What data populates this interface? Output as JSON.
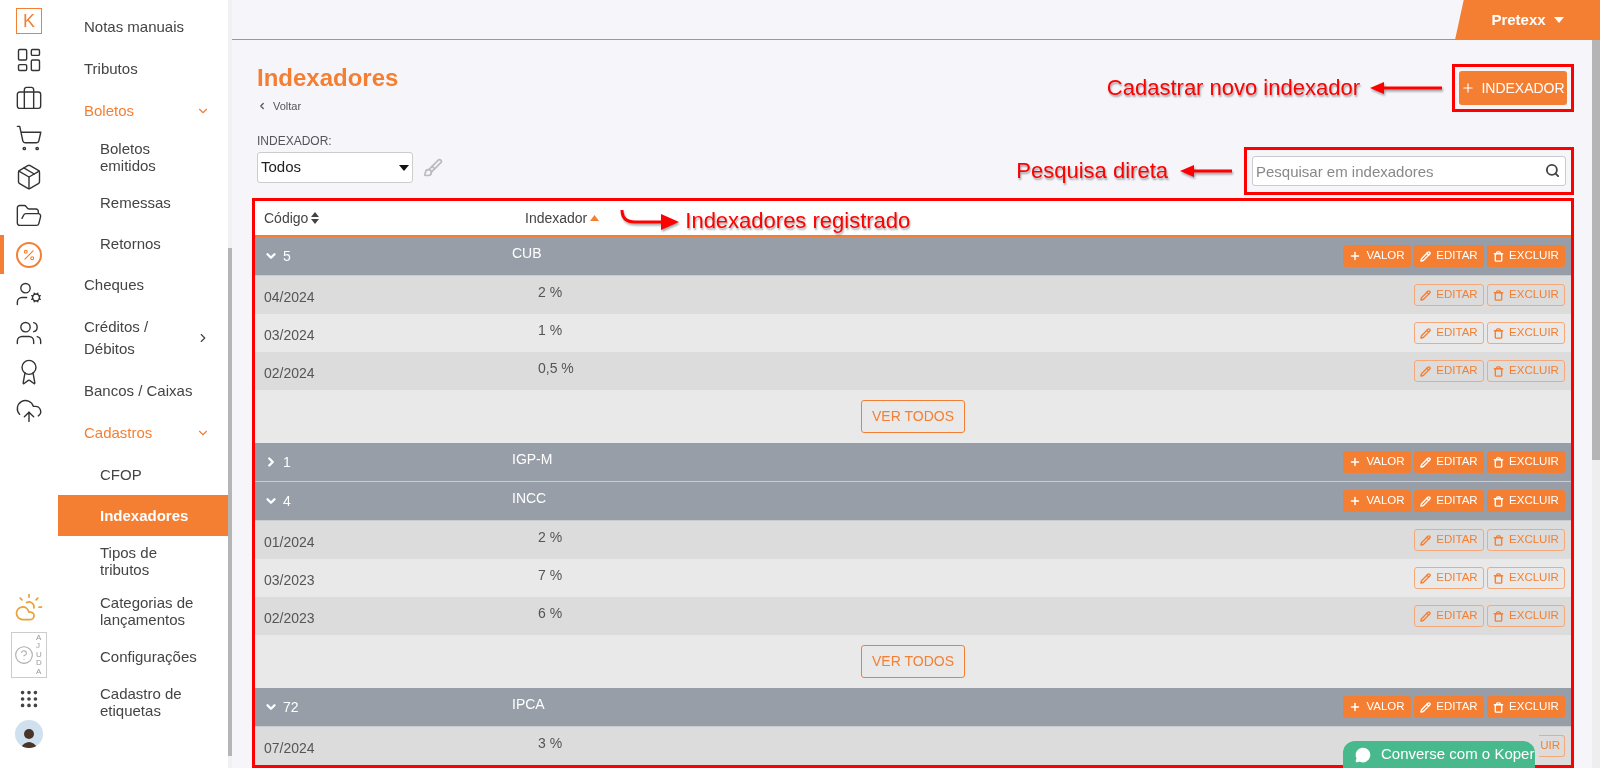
{
  "rail": {
    "logo": "K",
    "items": [
      {
        "selected": false
      },
      {
        "selected": false
      },
      {
        "selected": false
      },
      {
        "selected": false
      },
      {
        "selected": false
      },
      {
        "selected": true
      },
      {
        "selected": false
      },
      {
        "selected": false
      },
      {
        "selected": false
      },
      {
        "selected": false
      }
    ],
    "help_label": "AJUDA"
  },
  "sidebar": {
    "items": [
      {
        "label": "Notas manuais"
      },
      {
        "label": "Tributos"
      },
      {
        "label": "Boletos",
        "expanded": true,
        "children": [
          {
            "label": "Boletos emitidos",
            "selected": false
          },
          {
            "label": "Remessas",
            "selected": false
          },
          {
            "label": "Retornos",
            "selected": false
          }
        ]
      },
      {
        "label": "Cheques"
      },
      {
        "label": "Créditos / Débitos",
        "expanded": false
      },
      {
        "label": "Bancos / Caixas"
      },
      {
        "label": "Cadastros",
        "expanded": true,
        "children": [
          {
            "label": "CFOP",
            "selected": false
          },
          {
            "label": "Indexadores",
            "selected": true
          },
          {
            "label": "Tipos de tributos",
            "selected": false
          },
          {
            "label": "Categorias de lançamentos",
            "selected": false
          },
          {
            "label": "Configurações",
            "selected": false
          },
          {
            "label": "Cadastro de etiquetas",
            "selected": false
          }
        ]
      }
    ]
  },
  "user_menu": {
    "label": "Pretexx"
  },
  "page": {
    "title": "Indexadores",
    "back": "Voltar",
    "add_button": "INDEXADOR"
  },
  "filter": {
    "label": "INDEXADOR:",
    "value": "Todos"
  },
  "search": {
    "placeholder": "Pesquisar em indexadores"
  },
  "annotations": {
    "add": "Cadastrar novo indexador",
    "search": "Pesquisa direta",
    "table": "Indexadores registrado"
  },
  "table": {
    "columns": [
      {
        "label": "Código",
        "sorted": false
      },
      {
        "label": "Indexador",
        "sorted": true
      }
    ],
    "groups": [
      {
        "code": "5",
        "name": "CUB",
        "expanded": true,
        "actions": [
          {
            "kind": "add",
            "label": "VALOR"
          },
          {
            "kind": "edit",
            "label": "EDITAR"
          },
          {
            "kind": "delete",
            "label": "EXCLUIR"
          }
        ],
        "rows": [
          {
            "period": "04/2024",
            "value": "2 %",
            "actions": [
              {
                "kind": "edit",
                "label": "EDITAR"
              },
              {
                "kind": "delete",
                "label": "EXCLUIR"
              }
            ]
          },
          {
            "period": "03/2024",
            "value": "1 %",
            "actions": [
              {
                "kind": "edit",
                "label": "EDITAR"
              },
              {
                "kind": "delete",
                "label": "EXCLUIR"
              }
            ]
          },
          {
            "period": "02/2024",
            "value": "0,5 %",
            "actions": [
              {
                "kind": "edit",
                "label": "EDITAR"
              },
              {
                "kind": "delete",
                "label": "EXCLUIR"
              }
            ]
          }
        ],
        "more": "VER TODOS"
      },
      {
        "code": "1",
        "name": "IGP-M",
        "expanded": false,
        "actions": [
          {
            "kind": "add",
            "label": "VALOR"
          },
          {
            "kind": "edit",
            "label": "EDITAR"
          },
          {
            "kind": "delete",
            "label": "EXCLUIR"
          }
        ]
      },
      {
        "code": "4",
        "name": "INCC",
        "expanded": true,
        "actions": [
          {
            "kind": "add",
            "label": "VALOR"
          },
          {
            "kind": "edit",
            "label": "EDITAR"
          },
          {
            "kind": "delete",
            "label": "EXCLUIR"
          }
        ],
        "rows": [
          {
            "period": "01/2024",
            "value": "2 %",
            "actions": [
              {
                "kind": "edit",
                "label": "EDITAR"
              },
              {
                "kind": "delete",
                "label": "EXCLUIR"
              }
            ]
          },
          {
            "period": "03/2023",
            "value": "7 %",
            "actions": [
              {
                "kind": "edit",
                "label": "EDITAR"
              },
              {
                "kind": "delete",
                "label": "EXCLUIR"
              }
            ]
          },
          {
            "period": "02/2023",
            "value": "6 %",
            "actions": [
              {
                "kind": "edit",
                "label": "EDITAR"
              },
              {
                "kind": "delete",
                "label": "EXCLUIR"
              }
            ]
          }
        ],
        "more": "VER TODOS"
      },
      {
        "code": "72",
        "name": "IPCA",
        "expanded": true,
        "actions": [
          {
            "kind": "add",
            "label": "VALOR"
          },
          {
            "kind": "edit",
            "label": "EDITAR"
          },
          {
            "kind": "delete",
            "label": "EXCLUIR"
          }
        ],
        "rows": [
          {
            "period": "07/2024",
            "value": "3 %",
            "actions": [
              {
                "kind": "partial",
                "label": "UIR"
              }
            ]
          }
        ]
      }
    ]
  },
  "chat": {
    "label": "Converse com o Koper"
  }
}
